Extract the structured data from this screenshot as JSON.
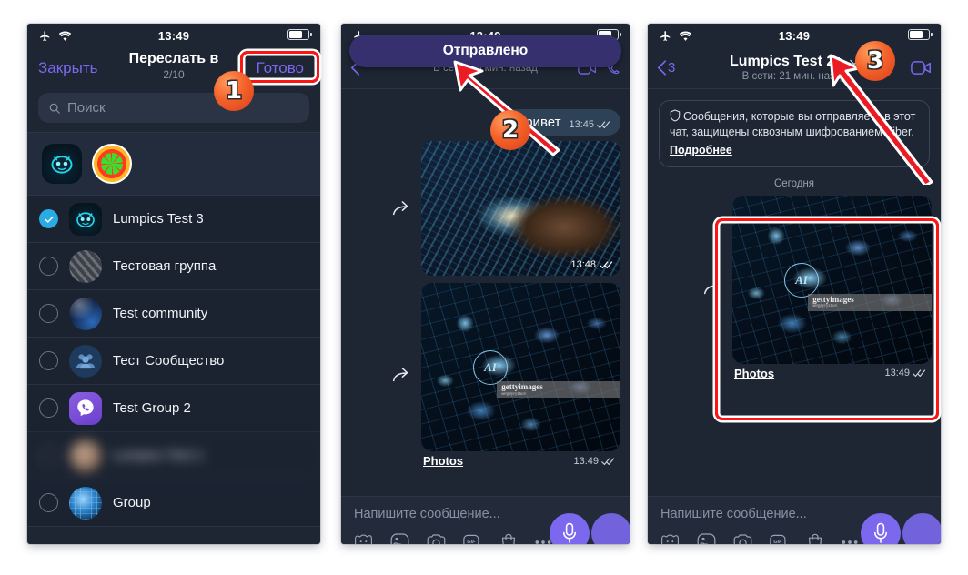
{
  "status_bar": {
    "time": "13:49",
    "airplane_icon": "airplane-icon",
    "wifi_icon": "wifi-icon",
    "battery_icon": "battery-icon"
  },
  "panel1": {
    "close_label": "Закрыть",
    "title": "Переслать в",
    "count": "2/10",
    "done_label": "Готово",
    "search_placeholder": "Поиск",
    "selected_avatars": [
      {
        "name": "cyanogen-avatar"
      },
      {
        "name": "lime-avatar"
      }
    ],
    "chats": [
      {
        "name": "Lumpics Test 3",
        "selected": true,
        "avatar": "cyanogen-avatar"
      },
      {
        "name": "Тестовая группа",
        "selected": false,
        "avatar": "city-avatar"
      },
      {
        "name": "Test community",
        "selected": false,
        "avatar": "space-avatar"
      },
      {
        "name": "Тест Сообщество",
        "selected": false,
        "avatar": "group-people-avatar"
      },
      {
        "name": "Test Group 2",
        "selected": false,
        "avatar": "viber-avatar"
      },
      {
        "name": "Lumpics Test 1",
        "selected": false,
        "avatar": "person-avatar",
        "blurred": true
      },
      {
        "name": "Group",
        "selected": false,
        "avatar": "globe-avatar"
      }
    ]
  },
  "panel2": {
    "toast": "Отправлено",
    "header": {
      "title": "",
      "subtitle": "В сети: 13 мин. назад"
    },
    "messages": [
      {
        "type": "text",
        "text": "Привет",
        "time": "13:45",
        "status": "read"
      },
      {
        "type": "media",
        "art": "hands",
        "time": "13:48",
        "status": "read",
        "forwarded": true
      },
      {
        "type": "media",
        "art": "ai",
        "caption": "Photos",
        "time": "13:49",
        "status": "read",
        "forwarded": true,
        "watermark": "gettyimages",
        "watermark_sub": "sergeyryzhov"
      }
    ],
    "composer": {
      "placeholder": "Напишите сообщение...",
      "icons": [
        "sticker-icon",
        "photo-icon",
        "camera-icon",
        "gif-icon",
        "shop-icon",
        "more-icon"
      ],
      "mic_icon": "microphone-icon"
    }
  },
  "panel3": {
    "back_label": "3",
    "header": {
      "title": "Lumpics Test 2+",
      "subtitle": "В сети: 21 мин. назад",
      "chevron": "chevron-down-icon",
      "video_icon": "video-call-icon"
    },
    "encryption_notice": {
      "icon": "shield-icon",
      "text": "Сообщения, которые вы отправляете в этот чат, защищены сквозным шифрованием Viber.",
      "link": "Подробнее"
    },
    "day_separator": "Сегодня",
    "message": {
      "type": "media",
      "art": "ai",
      "caption": "Photos",
      "time": "13:49",
      "status": "read",
      "forwarded": true,
      "watermark": "gettyimages",
      "watermark_sub": "sergeyryzhov"
    },
    "composer": {
      "placeholder": "Напишите сообщение...",
      "icons": [
        "sticker-icon",
        "photo-icon",
        "camera-icon",
        "gif-icon",
        "shop-icon",
        "more-icon"
      ],
      "mic_icon": "microphone-icon"
    }
  },
  "annotations": {
    "badges": [
      {
        "label": "1"
      },
      {
        "label": "2"
      },
      {
        "label": "3"
      }
    ],
    "accent_color": "#ff1414",
    "badge_color": "#f4622a"
  }
}
